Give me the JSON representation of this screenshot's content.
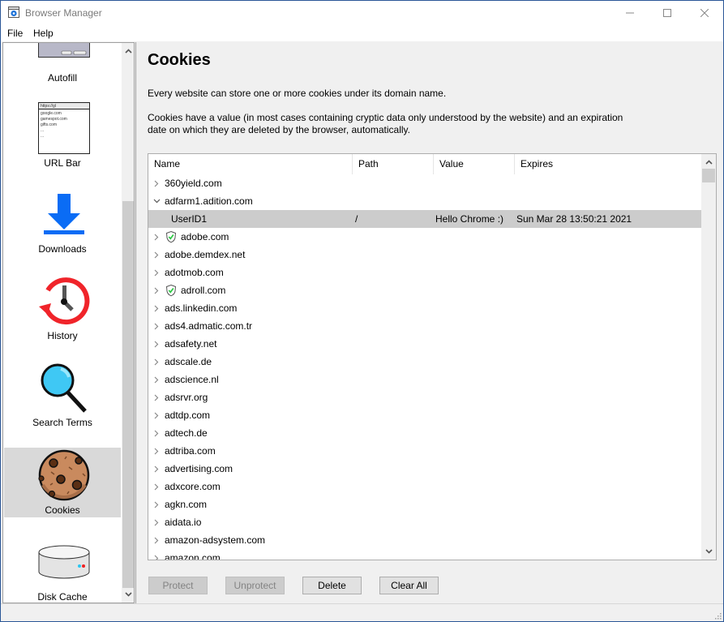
{
  "window": {
    "title": "Browser Manager",
    "controls": {
      "minimize": "minimize",
      "maximize": "maximize",
      "close": "close"
    }
  },
  "menu": {
    "file": "File",
    "help": "Help"
  },
  "sidebar": {
    "items": [
      {
        "id": "autofill",
        "label": "Autofill",
        "icon": "autofill-form-icon",
        "active": false
      },
      {
        "id": "url-bar",
        "label": "URL Bar",
        "icon": "url-bar-icon",
        "active": false,
        "preview": {
          "url": "https://gl",
          "entries": [
            "google.com",
            "gamespot.com",
            "gifts.com",
            "...",
            "..."
          ]
        }
      },
      {
        "id": "downloads",
        "label": "Downloads",
        "icon": "download-arrow-icon",
        "active": false
      },
      {
        "id": "history",
        "label": "History",
        "icon": "history-clock-icon",
        "active": false
      },
      {
        "id": "search-terms",
        "label": "Search Terms",
        "icon": "magnifier-icon",
        "active": false
      },
      {
        "id": "cookies",
        "label": "Cookies",
        "icon": "cookie-icon",
        "active": true
      },
      {
        "id": "disk-cache",
        "label": "Disk Cache",
        "icon": "disk-drive-icon",
        "active": false
      }
    ]
  },
  "main": {
    "title": "Cookies",
    "description1": "Every website can store one or more cookies under its domain name.",
    "description2": "Cookies have a value (in most cases containing cryptic data only understood by the website) and an expiration date on which they are deleted by the browser, automatically.",
    "columns": {
      "name": "Name",
      "path": "Path",
      "value": "Value",
      "expires": "Expires"
    },
    "rows": [
      {
        "type": "domain",
        "name": "360yield.com",
        "expanded": false,
        "protected": false
      },
      {
        "type": "domain",
        "name": "adfarm1.adition.com",
        "expanded": true,
        "protected": false
      },
      {
        "type": "cookie",
        "name": "UserID1",
        "path": "/",
        "value": "Hello Chrome :)",
        "expires": "Sun Mar 28 13:50:21 2021",
        "selected": true
      },
      {
        "type": "domain",
        "name": "adobe.com",
        "expanded": false,
        "protected": true
      },
      {
        "type": "domain",
        "name": "adobe.demdex.net",
        "expanded": false,
        "protected": false
      },
      {
        "type": "domain",
        "name": "adotmob.com",
        "expanded": false,
        "protected": false
      },
      {
        "type": "domain",
        "name": "adroll.com",
        "expanded": false,
        "protected": true
      },
      {
        "type": "domain",
        "name": "ads.linkedin.com",
        "expanded": false,
        "protected": false
      },
      {
        "type": "domain",
        "name": "ads4.admatic.com.tr",
        "expanded": false,
        "protected": false
      },
      {
        "type": "domain",
        "name": "adsafety.net",
        "expanded": false,
        "protected": false
      },
      {
        "type": "domain",
        "name": "adscale.de",
        "expanded": false,
        "protected": false
      },
      {
        "type": "domain",
        "name": "adscience.nl",
        "expanded": false,
        "protected": false
      },
      {
        "type": "domain",
        "name": "adsrvr.org",
        "expanded": false,
        "protected": false
      },
      {
        "type": "domain",
        "name": "adtdp.com",
        "expanded": false,
        "protected": false
      },
      {
        "type": "domain",
        "name": "adtech.de",
        "expanded": false,
        "protected": false
      },
      {
        "type": "domain",
        "name": "adtriba.com",
        "expanded": false,
        "protected": false
      },
      {
        "type": "domain",
        "name": "advertising.com",
        "expanded": false,
        "protected": false
      },
      {
        "type": "domain",
        "name": "adxcore.com",
        "expanded": false,
        "protected": false
      },
      {
        "type": "domain",
        "name": "agkn.com",
        "expanded": false,
        "protected": false
      },
      {
        "type": "domain",
        "name": "aidata.io",
        "expanded": false,
        "protected": false
      },
      {
        "type": "domain",
        "name": "amazon-adsystem.com",
        "expanded": false,
        "protected": false
      },
      {
        "type": "domain",
        "name": "amazon.com",
        "expanded": false,
        "protected": false
      }
    ],
    "buttons": {
      "protect": {
        "label": "Protect",
        "enabled": false
      },
      "unprotect": {
        "label": "Unprotect",
        "enabled": false
      },
      "delete": {
        "label": "Delete",
        "enabled": true
      },
      "clear_all": {
        "label": "Clear All",
        "enabled": true
      }
    }
  },
  "colors": {
    "window_border": "#2b5797",
    "selected_row": "#cccccc",
    "active_sidebar": "#d9d9d9",
    "download_blue": "#0a6cf5",
    "history_red": "#f0242a",
    "magnifier_cyan": "#3fc8f4",
    "cookie_brown": "#c98a5e",
    "shield_green": "#27c93f"
  }
}
